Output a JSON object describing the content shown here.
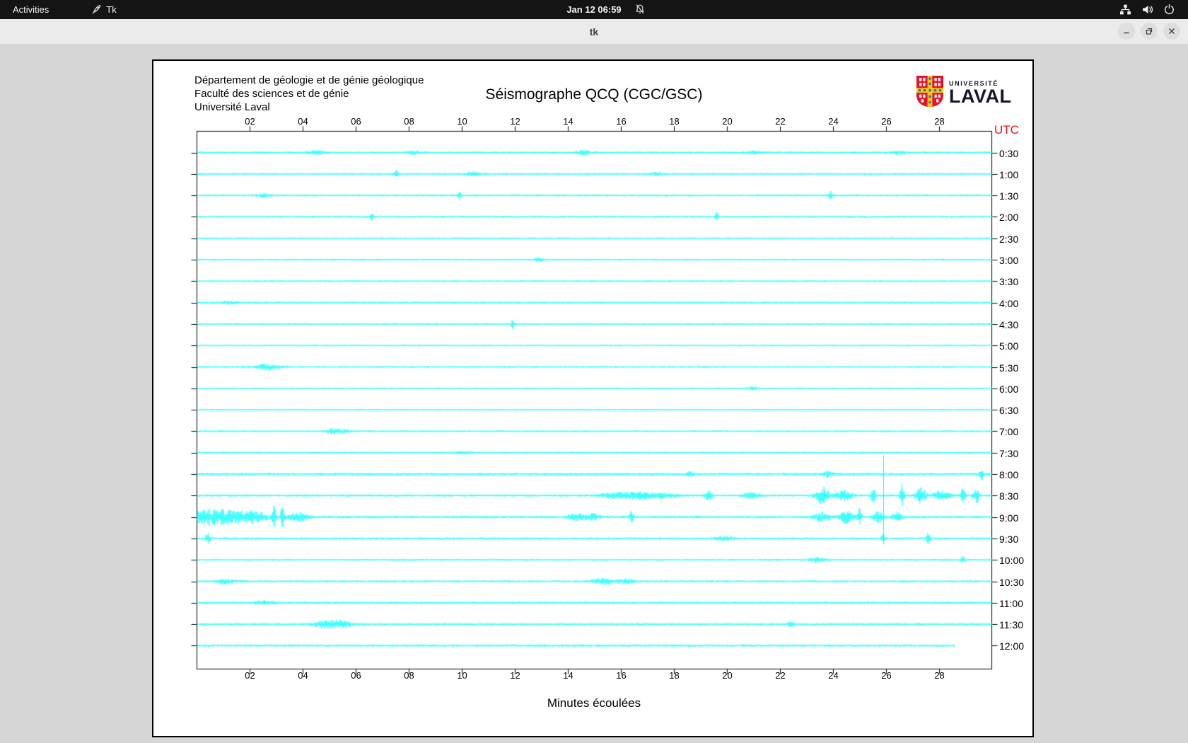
{
  "topbar": {
    "activities_label": "Activities",
    "app_name": "Tk",
    "clock": "Jan 12 06:59",
    "status_icons": [
      "notifications-off",
      "network",
      "volume",
      "power"
    ]
  },
  "titlebar": {
    "title": "tk",
    "buttons": [
      "minimize",
      "maximize",
      "close"
    ]
  },
  "header": {
    "dept_line1": "Département de géologie et de génie géologique",
    "dept_line2": "Faculté des sciences et de génie",
    "dept_line3": "Université Laval",
    "logo_small": "UNIVERSITÉ",
    "logo_large": "LAVAL"
  },
  "chart_data": {
    "type": "line",
    "title": "Séismographe QCQ (CGC/GSC)",
    "xlabel": "Minutes écoulées",
    "utc_axis_label": "UTC",
    "utc_label_color": "#ee1111",
    "trace_color": "#00ffff",
    "x_range": [
      0,
      30
    ],
    "x_ticks": [
      "02",
      "04",
      "06",
      "08",
      "10",
      "12",
      "14",
      "16",
      "18",
      "20",
      "22",
      "24",
      "26",
      "28"
    ],
    "row_interval_minutes": 30,
    "rows": [
      {
        "utc": "0:30",
        "noise": 1.5,
        "events": [
          {
            "m": 4.5,
            "a": 2.5,
            "w": 0.3
          },
          {
            "m": 8.2,
            "a": 2,
            "w": 0.25
          },
          {
            "m": 14.6,
            "a": 2.5,
            "w": 0.3
          },
          {
            "m": 21,
            "a": 2,
            "w": 0.3
          },
          {
            "m": 26.5,
            "a": 2.2,
            "w": 0.3
          }
        ]
      },
      {
        "utc": "1:00",
        "noise": 1.4,
        "events": [
          {
            "m": 7.5,
            "a": 7,
            "w": 0.07
          },
          {
            "m": 10.4,
            "a": 2.5,
            "w": 0.3
          },
          {
            "m": 17.3,
            "a": 2,
            "w": 0.25
          }
        ]
      },
      {
        "utc": "1:30",
        "noise": 1.4,
        "events": [
          {
            "m": 2.5,
            "a": 2,
            "w": 0.3
          },
          {
            "m": 9.9,
            "a": 5,
            "w": 0.07
          },
          {
            "m": 23.9,
            "a": 5.5,
            "w": 0.08
          }
        ]
      },
      {
        "utc": "2:00",
        "noise": 1.4,
        "events": [
          {
            "m": 6.6,
            "a": 6,
            "w": 0.07
          },
          {
            "m": 19.6,
            "a": 6,
            "w": 0.07
          }
        ]
      },
      {
        "utc": "2:30",
        "noise": 1.2,
        "events": []
      },
      {
        "utc": "3:00",
        "noise": 1.2,
        "events": [
          {
            "m": 12.9,
            "a": 2.5,
            "w": 0.15
          }
        ]
      },
      {
        "utc": "3:30",
        "noise": 1.2,
        "events": []
      },
      {
        "utc": "4:00",
        "noise": 1.3,
        "events": [
          {
            "m": 1.2,
            "a": 2,
            "w": 0.3
          }
        ]
      },
      {
        "utc": "4:30",
        "noise": 1.3,
        "events": [
          {
            "m": 11.9,
            "a": 9,
            "w": 0.06
          }
        ]
      },
      {
        "utc": "5:00",
        "noise": 1.2,
        "events": []
      },
      {
        "utc": "5:30",
        "noise": 1.3,
        "events": [
          {
            "m": 2.7,
            "a": 4,
            "w": 0.5
          }
        ]
      },
      {
        "utc": "6:00",
        "noise": 1.2,
        "events": [
          {
            "m": 21,
            "a": 2,
            "w": 0.2
          }
        ]
      },
      {
        "utc": "6:30",
        "noise": 1.2,
        "events": []
      },
      {
        "utc": "7:00",
        "noise": 1.3,
        "events": [
          {
            "m": 5.3,
            "a": 4,
            "w": 0.4
          }
        ]
      },
      {
        "utc": "7:30",
        "noise": 1.3,
        "events": [
          {
            "m": 10,
            "a": 2,
            "w": 0.3
          }
        ]
      },
      {
        "utc": "8:00",
        "noise": 1.7,
        "events": [
          {
            "m": 18.6,
            "a": 3,
            "w": 0.15
          },
          {
            "m": 23.8,
            "a": 4,
            "w": 0.2
          },
          {
            "m": 29.6,
            "a": 9,
            "w": 0.07
          }
        ]
      },
      {
        "utc": "8:30",
        "noise": 1.6,
        "events": [
          {
            "m": 15.8,
            "a": 4,
            "w": 0.6
          },
          {
            "m": 16.7,
            "a": 5,
            "w": 0.4
          },
          {
            "m": 17.6,
            "a": 4,
            "w": 0.5
          },
          {
            "m": 19.3,
            "a": 6,
            "w": 0.15
          },
          {
            "m": 20.9,
            "a": 4,
            "w": 0.3
          },
          {
            "m": 23.6,
            "a": 12,
            "w": 0.25
          },
          {
            "m": 24.4,
            "a": 7,
            "w": 0.3
          },
          {
            "m": 25.5,
            "a": 14,
            "w": 0.08
          },
          {
            "m": 25.9,
            "a": 60,
            "w": 0.05
          },
          {
            "m": 26.6,
            "a": 16,
            "w": 0.08
          },
          {
            "m": 27.3,
            "a": 12,
            "w": 0.18
          },
          {
            "m": 28.1,
            "a": 7,
            "w": 0.3
          },
          {
            "m": 28.9,
            "a": 9,
            "w": 0.1
          },
          {
            "m": 29.4,
            "a": 11,
            "w": 0.1
          }
        ]
      },
      {
        "utc": "9:00",
        "noise": 1.8,
        "events": [
          {
            "m": 0.3,
            "a": 8,
            "w": 0.5
          },
          {
            "m": 1.1,
            "a": 9,
            "w": 0.7
          },
          {
            "m": 2.1,
            "a": 8,
            "w": 0.5
          },
          {
            "m": 2.9,
            "a": 14,
            "w": 0.07
          },
          {
            "m": 3.2,
            "a": 15,
            "w": 0.06
          },
          {
            "m": 3.8,
            "a": 6,
            "w": 0.4
          },
          {
            "m": 14.3,
            "a": 5,
            "w": 0.3
          },
          {
            "m": 14.9,
            "a": 4,
            "w": 0.3
          },
          {
            "m": 16.4,
            "a": 7,
            "w": 0.08
          },
          {
            "m": 23.6,
            "a": 6,
            "w": 0.3
          },
          {
            "m": 24.5,
            "a": 9,
            "w": 0.25
          },
          {
            "m": 25.0,
            "a": 12,
            "w": 0.08
          },
          {
            "m": 25.7,
            "a": 7,
            "w": 0.2
          },
          {
            "m": 26.4,
            "a": 6,
            "w": 0.2
          }
        ]
      },
      {
        "utc": "9:30",
        "noise": 1.6,
        "events": [
          {
            "m": 0.4,
            "a": 8,
            "w": 0.08
          },
          {
            "m": 19.9,
            "a": 3,
            "w": 0.3
          },
          {
            "m": 25.9,
            "a": 5,
            "w": 0.08
          },
          {
            "m": 27.6,
            "a": 9,
            "w": 0.07
          }
        ]
      },
      {
        "utc": "10:00",
        "noise": 1.4,
        "events": [
          {
            "m": 23.4,
            "a": 3.5,
            "w": 0.3
          },
          {
            "m": 28.9,
            "a": 5,
            "w": 0.08
          }
        ]
      },
      {
        "utc": "10:30",
        "noise": 1.5,
        "events": [
          {
            "m": 1.1,
            "a": 3,
            "w": 0.4
          },
          {
            "m": 15.3,
            "a": 4,
            "w": 0.4
          },
          {
            "m": 16.2,
            "a": 3,
            "w": 0.3
          }
        ]
      },
      {
        "utc": "11:00",
        "noise": 1.6,
        "events": [
          {
            "m": 2.5,
            "a": 2.5,
            "w": 0.4
          }
        ]
      },
      {
        "utc": "11:30",
        "noise": 1.6,
        "events": [
          {
            "m": 4.9,
            "a": 5,
            "w": 0.5
          },
          {
            "m": 5.5,
            "a": 4,
            "w": 0.3
          },
          {
            "m": 22.4,
            "a": 3,
            "w": 0.12
          }
        ]
      },
      {
        "utc": "12:00",
        "noise": 1.7,
        "end": 28.6,
        "events": []
      }
    ]
  }
}
